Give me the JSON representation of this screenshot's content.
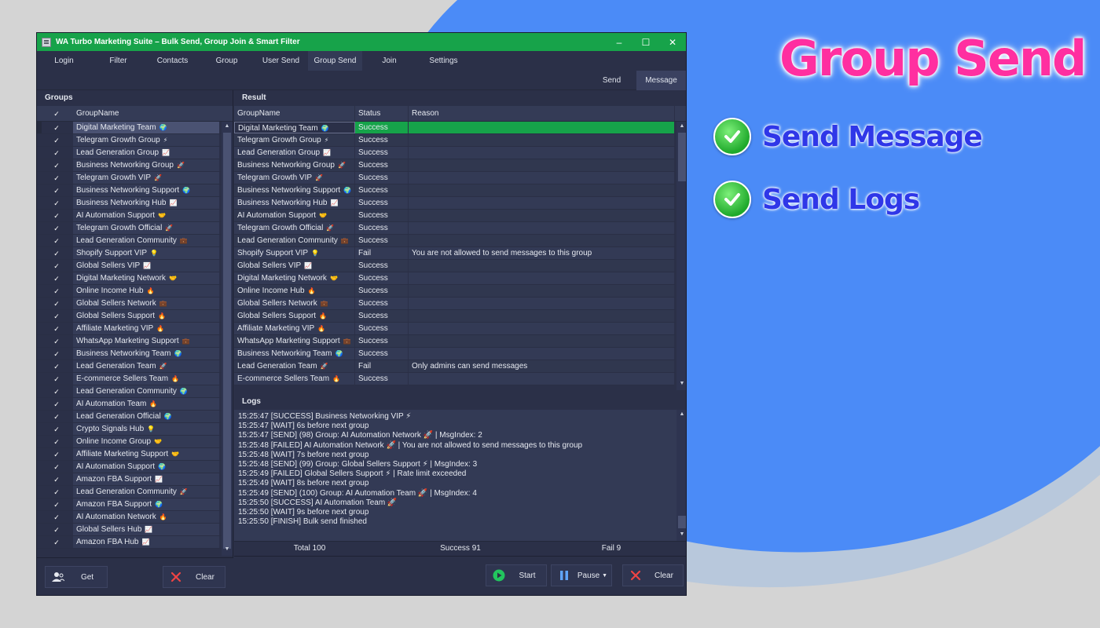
{
  "promo": {
    "title": "Group Send",
    "features": [
      "Send Message",
      "Send Logs"
    ]
  },
  "window": {
    "title": "WA Turbo Marketing Suite – Bulk Send, Group Join & Smart Filter",
    "controls": [
      "–",
      "☐",
      "✕"
    ]
  },
  "tabs": [
    "Login",
    "Filter",
    "Contacts",
    "Group",
    "User Send",
    "Group Send",
    "Join",
    "Settings"
  ],
  "active_tab": "Group Send",
  "subtabs": [
    "Send",
    "Message"
  ],
  "groups_panel": {
    "title": "Groups",
    "column_header": "GroupName",
    "check_header": "✓",
    "rows": [
      {
        "name": "Digital Marketing Team",
        "icon": "🌍"
      },
      {
        "name": "Telegram Growth Group",
        "icon": "⚡"
      },
      {
        "name": "Lead Generation Group",
        "icon": "📈"
      },
      {
        "name": "Business Networking Group",
        "icon": "🚀"
      },
      {
        "name": "Telegram Growth VIP",
        "icon": "🚀"
      },
      {
        "name": "Business Networking Support",
        "icon": "🌍"
      },
      {
        "name": "Business Networking Hub",
        "icon": "📈"
      },
      {
        "name": "AI Automation Support",
        "icon": "🤝"
      },
      {
        "name": "Telegram Growth Official",
        "icon": "🚀"
      },
      {
        "name": "Lead Generation Community",
        "icon": "💼"
      },
      {
        "name": "Shopify Support VIP",
        "icon": "💡"
      },
      {
        "name": "Global Sellers VIP",
        "icon": "📈"
      },
      {
        "name": "Digital Marketing Network",
        "icon": "🤝"
      },
      {
        "name": "Online Income Hub",
        "icon": "🔥"
      },
      {
        "name": "Global Sellers Network",
        "icon": "💼"
      },
      {
        "name": "Global Sellers Support",
        "icon": "🔥"
      },
      {
        "name": "Affiliate Marketing VIP",
        "icon": "🔥"
      },
      {
        "name": "WhatsApp Marketing Support",
        "icon": "💼"
      },
      {
        "name": "Business Networking Team",
        "icon": "🌍"
      },
      {
        "name": "Lead Generation Team",
        "icon": "🚀"
      },
      {
        "name": "E-commerce Sellers Team",
        "icon": "🔥"
      },
      {
        "name": "Lead Generation Community",
        "icon": "🌍"
      },
      {
        "name": "AI Automation Team",
        "icon": "🔥"
      },
      {
        "name": "Lead Generation Official",
        "icon": "🌍"
      },
      {
        "name": "Crypto Signals Hub",
        "icon": "💡"
      },
      {
        "name": "Online Income Group",
        "icon": "🤝"
      },
      {
        "name": "Affiliate Marketing Support",
        "icon": "🤝"
      },
      {
        "name": "AI Automation Support",
        "icon": "🌍"
      },
      {
        "name": "Amazon FBA Support",
        "icon": "📈"
      },
      {
        "name": "Lead Generation Community",
        "icon": "🚀"
      },
      {
        "name": "Amazon FBA Support",
        "icon": "🌍"
      },
      {
        "name": "AI Automation Network",
        "icon": "🔥"
      },
      {
        "name": "Global Sellers Hub",
        "icon": "📈"
      },
      {
        "name": "Amazon FBA Hub",
        "icon": "📈"
      }
    ],
    "get_button": "Get",
    "clear_button": "Clear"
  },
  "result_panel": {
    "title": "Result",
    "columns": [
      "GroupName",
      "Status",
      "Reason"
    ],
    "rows": [
      {
        "name": "Digital Marketing Team",
        "icon": "🌍",
        "status": "Success",
        "reason": ""
      },
      {
        "name": "Telegram Growth Group",
        "icon": "⚡",
        "status": "Success",
        "reason": ""
      },
      {
        "name": "Lead Generation Group",
        "icon": "📈",
        "status": "Success",
        "reason": ""
      },
      {
        "name": "Business Networking Group",
        "icon": "🚀",
        "status": "Success",
        "reason": ""
      },
      {
        "name": "Telegram Growth VIP",
        "icon": "🚀",
        "status": "Success",
        "reason": ""
      },
      {
        "name": "Business Networking Support",
        "icon": "🌍",
        "status": "Success",
        "reason": ""
      },
      {
        "name": "Business Networking Hub",
        "icon": "📈",
        "status": "Success",
        "reason": ""
      },
      {
        "name": "AI Automation Support",
        "icon": "🤝",
        "status": "Success",
        "reason": ""
      },
      {
        "name": "Telegram Growth Official",
        "icon": "🚀",
        "status": "Success",
        "reason": ""
      },
      {
        "name": "Lead Generation Community",
        "icon": "💼",
        "status": "Success",
        "reason": ""
      },
      {
        "name": "Shopify Support VIP",
        "icon": "💡",
        "status": "Fail",
        "reason": "You are not allowed to send messages to this group"
      },
      {
        "name": "Global Sellers VIP",
        "icon": "📈",
        "status": "Success",
        "reason": ""
      },
      {
        "name": "Digital Marketing Network",
        "icon": "🤝",
        "status": "Success",
        "reason": ""
      },
      {
        "name": "Online Income Hub",
        "icon": "🔥",
        "status": "Success",
        "reason": ""
      },
      {
        "name": "Global Sellers Network",
        "icon": "💼",
        "status": "Success",
        "reason": ""
      },
      {
        "name": "Global Sellers Support",
        "icon": "🔥",
        "status": "Success",
        "reason": ""
      },
      {
        "name": "Affiliate Marketing VIP",
        "icon": "🔥",
        "status": "Success",
        "reason": ""
      },
      {
        "name": "WhatsApp Marketing Support",
        "icon": "💼",
        "status": "Success",
        "reason": ""
      },
      {
        "name": "Business Networking Team",
        "icon": "🌍",
        "status": "Success",
        "reason": ""
      },
      {
        "name": "Lead Generation Team",
        "icon": "🚀",
        "status": "Fail",
        "reason": "Only admins can send messages"
      },
      {
        "name": "E-commerce Sellers Team",
        "icon": "🔥",
        "status": "Success",
        "reason": ""
      }
    ]
  },
  "logs_panel": {
    "title": "Logs",
    "lines": [
      "15:25:47 [SUCCESS] Business Networking VIP ⚡",
      "15:25:47 [WAIT] 6s before next group",
      "15:25:47 [SEND] (98) Group: AI Automation Network 🚀 | MsgIndex: 2",
      "15:25:48 [FAILED] AI Automation Network 🚀 | You are not allowed to send messages to this group",
      "15:25:48 [WAIT] 7s before next group",
      "15:25:48 [SEND] (99) Group: Global Sellers Support ⚡ | MsgIndex: 3",
      "15:25:49 [FAILED] Global Sellers Support ⚡ | Rate limit exceeded",
      "15:25:49 [WAIT] 8s before next group",
      "15:25:49 [SEND] (100) Group: AI Automation Team 🚀 | MsgIndex: 4",
      "15:25:50 [SUCCESS] AI Automation Team 🚀",
      "15:25:50 [WAIT] 9s before next group",
      "15:25:50 [FINISH] Bulk send finished"
    ]
  },
  "stats": {
    "total": "Total 100",
    "success": "Success 91",
    "fail": "Fail 9"
  },
  "actions": {
    "start": "Start",
    "pause": "Pause",
    "clear": "Clear"
  },
  "colors": {
    "titlebar": "#17a34a",
    "highlight_row": "#16a34a",
    "window_bg": "#2b3048",
    "promo_title": "#ff2fa0",
    "feature_text": "#2f37e8",
    "background_blob": "#4b8bf7"
  }
}
